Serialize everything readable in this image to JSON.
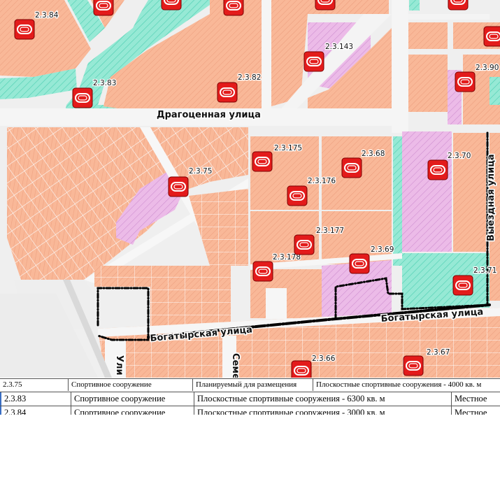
{
  "map": {
    "colors": {
      "residential": "#f9b898",
      "residential_stripe": "#e9906f",
      "green": "#8ee6d1",
      "green_stripe": "#4ccdb0",
      "sport_zone": "#e8b4e4",
      "sport_zone_stripe": "#c87ccb",
      "road": "#f4f4f4",
      "marker": "#e31b1b",
      "boundary": "#000000"
    },
    "marker_icon": "sport-facility-icon",
    "streets": [
      {
        "id": "dragocennaya",
        "label": "Драгоценная улица"
      },
      {
        "id": "bogatyrskaya-west",
        "label": "Богатырская улица"
      },
      {
        "id": "bogatyrskaya-east",
        "label": "Богатырская улица"
      },
      {
        "id": "vyezdnaya",
        "label": "Выездная улица"
      },
      {
        "id": "semenovskaya-cut",
        "label": "Семе"
      },
      {
        "id": "ulica-cut",
        "label": "Ули"
      }
    ],
    "zones": [
      {
        "id": "2.3.84",
        "label": "2.3.84"
      },
      {
        "id": "2.3.83",
        "label": "2.3.83"
      },
      {
        "id": "2.3.82",
        "label": "2.3.82"
      },
      {
        "id": "2.3.143",
        "label": "2.3.143"
      },
      {
        "id": "2.3.90",
        "label": "2.3.90"
      },
      {
        "id": "2.3.175",
        "label": "2.3.175"
      },
      {
        "id": "2.3.68",
        "label": "2.3.68"
      },
      {
        "id": "2.3.70",
        "label": "2.3.70"
      },
      {
        "id": "2.3.75",
        "label": "2.3.75"
      },
      {
        "id": "2.3.176",
        "label": "2.3.176"
      },
      {
        "id": "2.3.177",
        "label": "2.3.177"
      },
      {
        "id": "2.3.69",
        "label": "2.3.69"
      },
      {
        "id": "2.3.178",
        "label": "2.3.178"
      },
      {
        "id": "2.3.71",
        "label": "2.3.71"
      },
      {
        "id": "2.3.66",
        "label": "2.3.66"
      },
      {
        "id": "2.3.67",
        "label": "2.3.67"
      }
    ]
  },
  "table": {
    "rows": [
      {
        "code": "2.3.75",
        "type": "Спортивное сооружение",
        "status": "Планируемый для размещения",
        "description": "Плоскостные спортивные сооружения - 4000 кв. м",
        "significance": ""
      },
      {
        "code": "2.3.83",
        "type": "Спортивное сооружение",
        "status": "",
        "description": "Плоскостные спортивные сооружения - 6300 кв. м",
        "significance": "Местное"
      },
      {
        "code": "2.3.84",
        "type": "Спортивное сооружение",
        "status": "",
        "description": "Плоскостные спортивные сооружения - 3000 кв. м",
        "significance": "Местное"
      }
    ]
  }
}
